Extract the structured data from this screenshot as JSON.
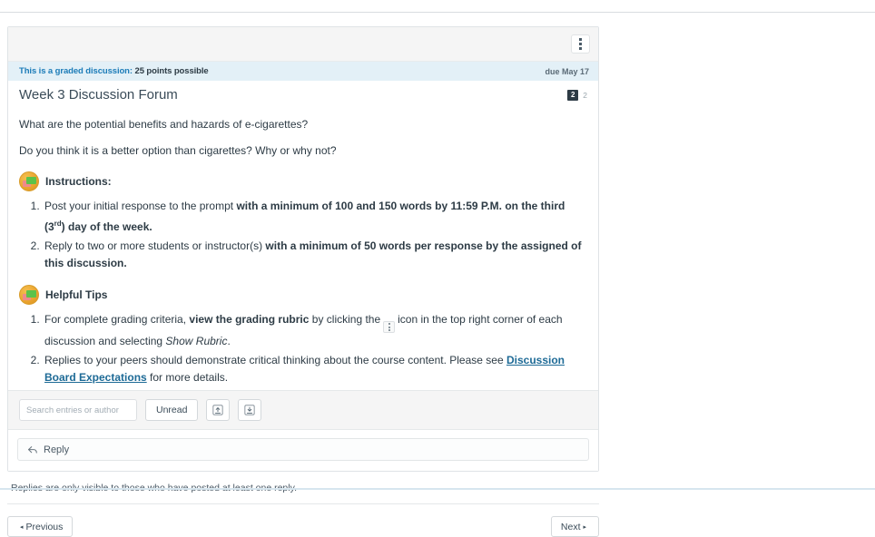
{
  "panel": {
    "kebab_menu_name": "Manage Discussion",
    "graded_notice_label": "This is a graded discussion:",
    "graded_notice_points": "25 points possible",
    "due_text": "due May 17",
    "unread_count": "2",
    "total_count": "2",
    "title": "Week 3 Discussion Forum",
    "prompt_line_1": "What are the potential benefits and hazards of e-cigarettes?",
    "prompt_line_2": "Do you think it is a better option than cigarettes? Why or why not?"
  },
  "instructions": {
    "heading": "Instructions:",
    "item_1": {
      "plain_start": "Post your initial response to the prompt ",
      "bold_a": "with a minimum of 100 and 150 words by 11:59 P.M. on the third (3",
      "sup": "rd",
      "bold_b": ") day of the week."
    },
    "item_2": {
      "plain_start": "Reply to two or more students or instructor(s) ",
      "bold": "with a minimum of 50 words per response by the assigned of this discussion."
    }
  },
  "helpful_tips": {
    "heading": "Helpful Tips",
    "item_1": {
      "part_1": "For complete grading criteria, ",
      "bold": "view the grading rubric",
      "part_2": " by clicking the",
      "part_3": "icon in the top right corner of each discussion and selecting ",
      "italic": "Show Rubric",
      "part_4": "."
    },
    "item_2": {
      "part_1": "Replies to your peers should demonstrate critical thinking about the course content. Please see ",
      "link": "Discussion Board Expectations",
      "part_2": " for more details."
    }
  },
  "toolbar": {
    "search_placeholder": "Search entries or author",
    "search_value": "",
    "unread_label": "Unread",
    "collapse_icon_name": "collapse-threads-icon",
    "expand_icon_name": "expand-threads-icon"
  },
  "reply": {
    "label": "Reply",
    "icon_name": "reply-arrow-icon"
  },
  "footer": {
    "note": "Replies are only visible to those who have posted at least one reply.",
    "previous_label": "Previous",
    "next_label": "Next",
    "prev_caret": "◂",
    "next_caret": "▸"
  },
  "colors": {
    "accent_blue": "#1c7cb8",
    "banner_bg": "#e3f0f7",
    "link": "#1d6a96",
    "badge_orange": "#e8a12c",
    "text": "#2d3b45"
  }
}
